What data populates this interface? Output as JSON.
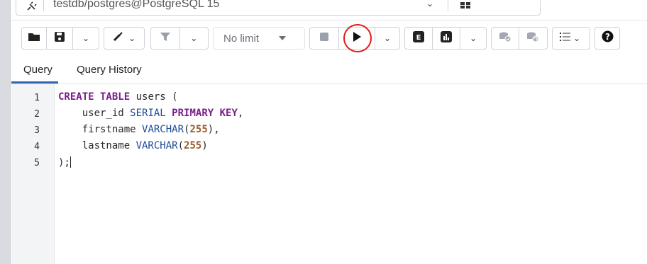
{
  "connection": {
    "label": "testdb/postgres@PostgreSQL 15",
    "icon": "connection-plug-icon",
    "status_icon": "connection-status-icon"
  },
  "toolbar": {
    "open_file_icon": "folder-icon",
    "save_icon": "save-icon",
    "edit_icon": "pencil-icon",
    "filter_icon": "filter-icon",
    "limit_label": "No limit",
    "stop_icon": "stop-icon",
    "execute_icon": "play-icon",
    "explain_icon": "explain-icon",
    "explain_analyze_icon": "chart-icon",
    "commit_icon": "commit-icon",
    "rollback_icon": "rollback-icon",
    "macros_icon": "list-icon",
    "help_icon": "help-icon",
    "highlight_color": "#e01b1b"
  },
  "tabs": [
    {
      "label": "Query",
      "active": true
    },
    {
      "label": "Query History",
      "active": false
    }
  ],
  "editor": {
    "line_numbers": [
      "1",
      "2",
      "3",
      "4",
      "5"
    ],
    "lines": [
      {
        "segments": [
          {
            "t": "CREATE TABLE",
            "c": "kw"
          },
          {
            "t": " users (",
            "c": ""
          }
        ]
      },
      {
        "segments": [
          {
            "t": "    user_id ",
            "c": ""
          },
          {
            "t": "SERIAL",
            "c": "fn"
          },
          {
            "t": " ",
            "c": ""
          },
          {
            "t": "PRIMARY KEY",
            "c": "kw"
          },
          {
            "t": ",",
            "c": ""
          }
        ]
      },
      {
        "segments": [
          {
            "t": "    firstname ",
            "c": ""
          },
          {
            "t": "VARCHAR",
            "c": "fn"
          },
          {
            "t": "(",
            "c": ""
          },
          {
            "t": "255",
            "c": "num"
          },
          {
            "t": "),",
            "c": ""
          }
        ]
      },
      {
        "segments": [
          {
            "t": "    lastname ",
            "c": ""
          },
          {
            "t": "VARCHAR",
            "c": "fn"
          },
          {
            "t": "(",
            "c": ""
          },
          {
            "t": "255",
            "c": "num"
          },
          {
            "t": ")",
            "c": ""
          }
        ]
      },
      {
        "segments": [
          {
            "t": ");",
            "c": ""
          }
        ]
      }
    ]
  }
}
